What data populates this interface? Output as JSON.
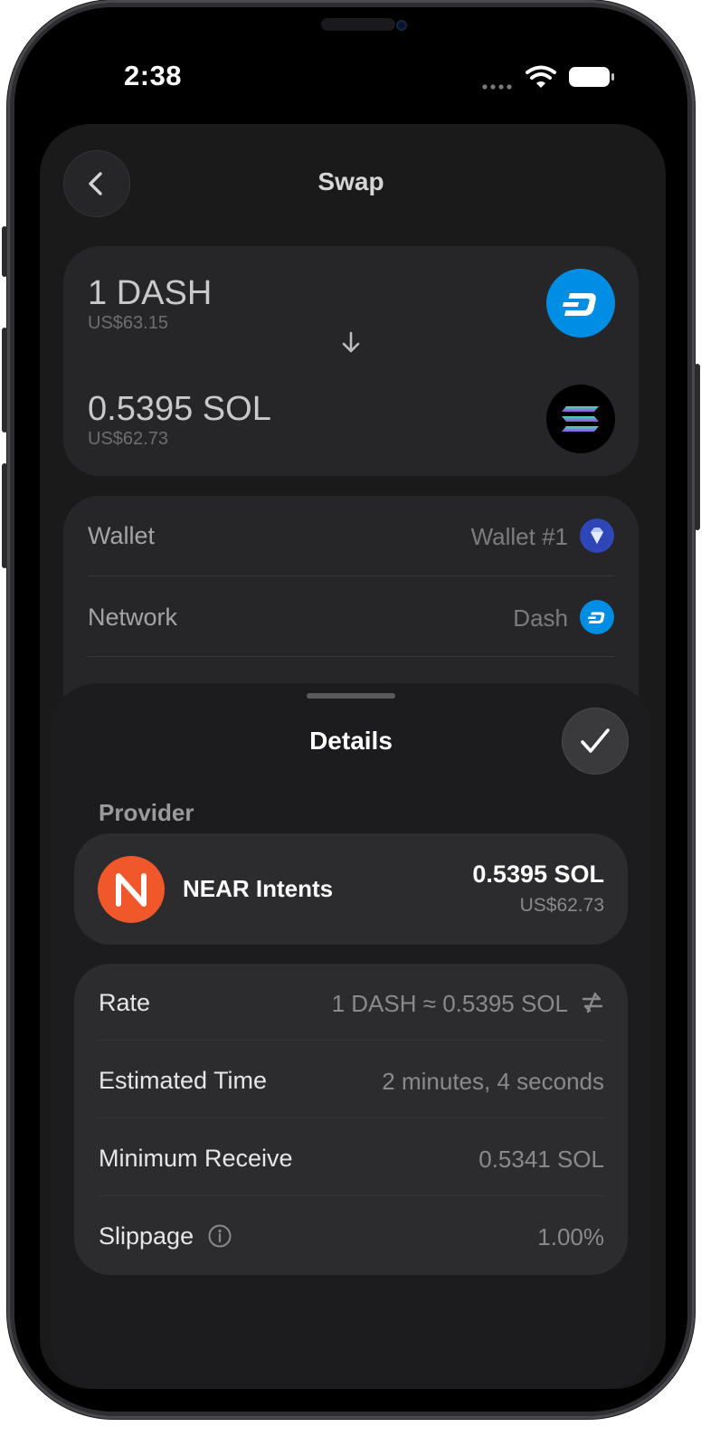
{
  "status_bar": {
    "time": "2:38"
  },
  "header": {
    "title": "Swap"
  },
  "swap": {
    "from_amount": "1 DASH",
    "from_fiat": "US$63.15",
    "to_amount": "0.5395 SOL",
    "to_fiat": "US$62.73"
  },
  "info": {
    "wallet_label": "Wallet",
    "wallet_value": "Wallet #1",
    "network_label": "Network",
    "network_value": "Dash"
  },
  "details": {
    "title": "Details",
    "provider_section": "Provider",
    "provider": {
      "name": "NEAR Intents",
      "amount": "0.5395 SOL",
      "fiat": "US$62.73"
    },
    "rows": [
      {
        "label": "Rate",
        "value": "1 DASH ≈ 0.5395 SOL"
      },
      {
        "label": "Estimated Time",
        "value": "2 minutes, 4 seconds"
      },
      {
        "label": "Minimum Receive",
        "value": "0.5341 SOL"
      },
      {
        "label": "Slippage",
        "value": "1.00%"
      }
    ]
  },
  "icons": {
    "back": "chevron-left-icon",
    "swap_direction": "arrow-down-icon",
    "from_coin": "dash-coin-icon",
    "to_coin": "solana-coin-icon",
    "wallet": "diamond-icon",
    "network": "dash-coin-icon",
    "done": "checkmark-icon",
    "provider": "near-logo-icon",
    "rate_toggle": "swap-arrows-icon",
    "slippage_info": "info-icon"
  },
  "colors": {
    "dash_blue": "#008de4",
    "near_orange": "#f0582c",
    "background": "#000000",
    "card": "#262628"
  }
}
